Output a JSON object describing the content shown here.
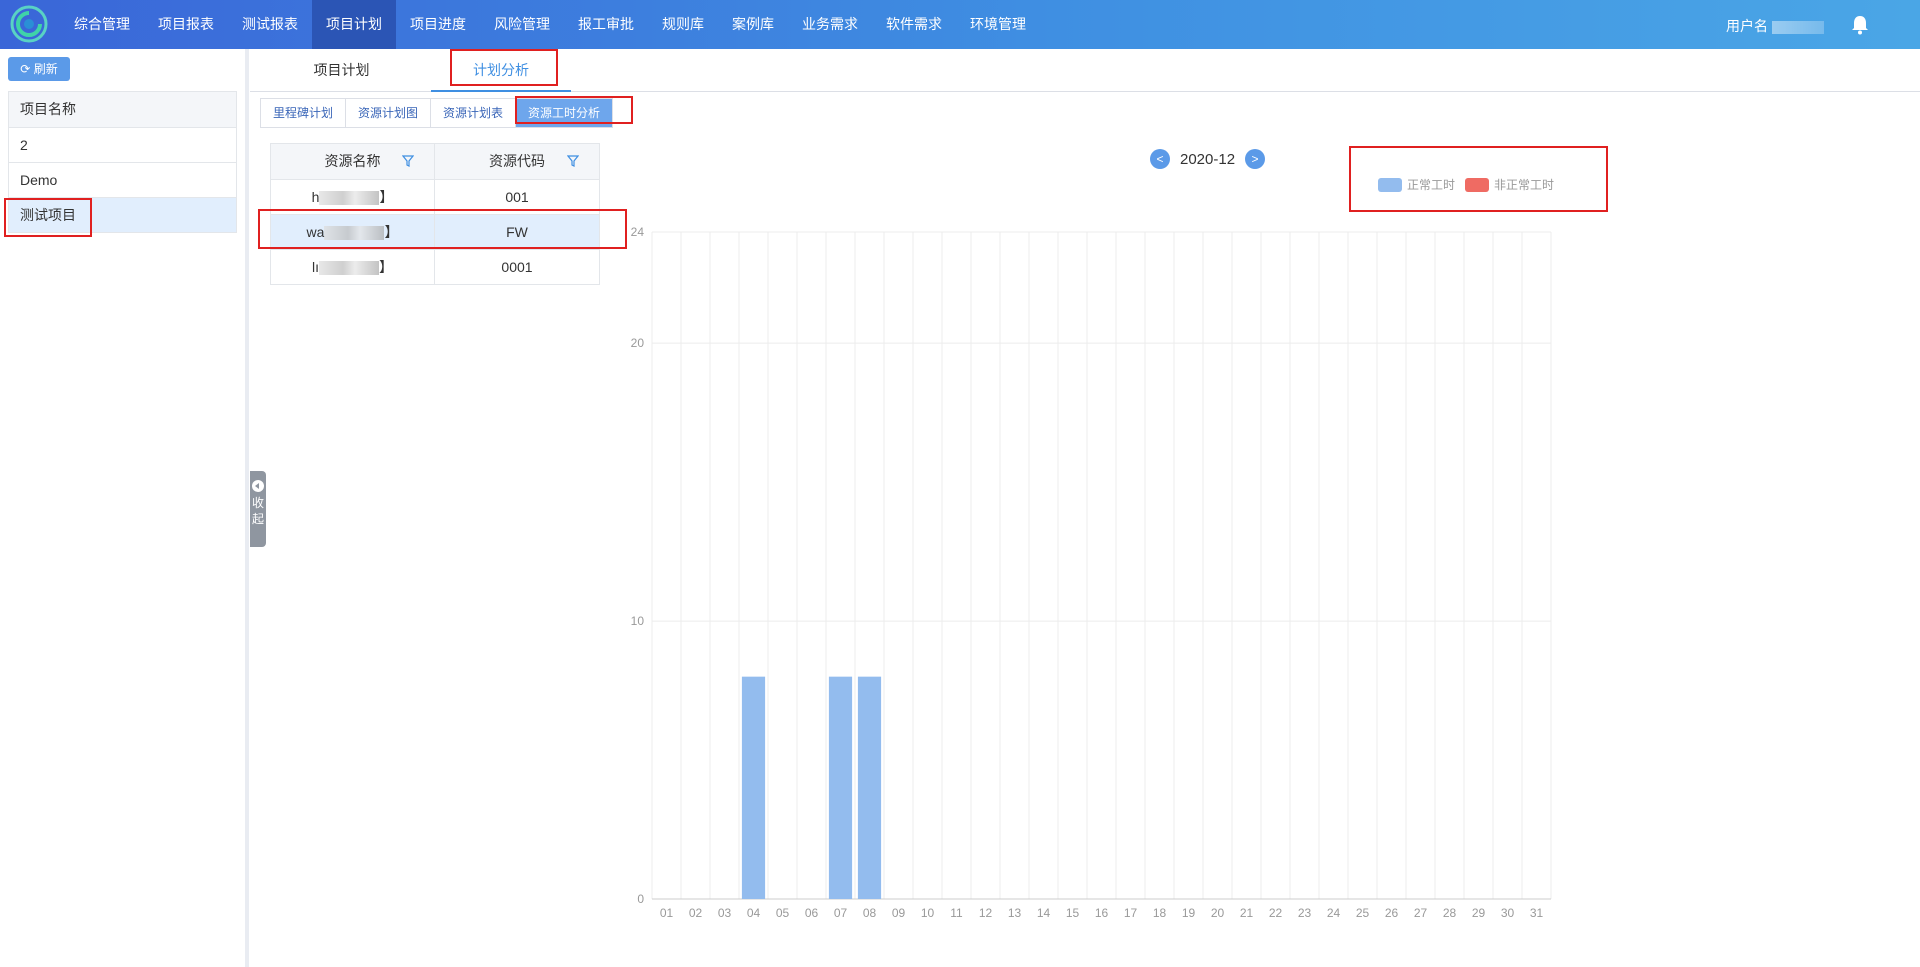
{
  "nav": {
    "items": [
      "综合管理",
      "项目报表",
      "测试报表",
      "项目计划",
      "项目进度",
      "风险管理",
      "报工审批",
      "规则库",
      "案例库",
      "业务需求",
      "软件需求",
      "环境管理"
    ],
    "active_index": 3,
    "user_label": "用户名"
  },
  "sidebar": {
    "refresh_label": "刷新",
    "header": "项目名称",
    "projects": [
      "2",
      "Demo",
      "测试项目"
    ],
    "selected_index": 2,
    "collapse_label": [
      "收",
      "起"
    ]
  },
  "tabs": {
    "main": [
      "项目计划",
      "计划分析"
    ],
    "active_main": 1,
    "sub": [
      "里程碑计划",
      "资源计划图",
      "资源计划表",
      "资源工时分析"
    ],
    "active_sub": 3
  },
  "resource_table": {
    "headers": [
      "资源名称",
      "资源代码"
    ],
    "rows": [
      {
        "name_prefix": "h",
        "name_suffix": "】",
        "code": "001"
      },
      {
        "name_prefix": "wa",
        "name_suffix": "】",
        "code": "FW"
      },
      {
        "name_prefix": "lı",
        "name_suffix": "】",
        "code": "0001"
      }
    ],
    "selected_index": 1
  },
  "month_nav": {
    "prev": "<",
    "next": ">",
    "label": "2020-12"
  },
  "colors": {
    "accent": "#3f8fe2",
    "normal": "#93bcee",
    "abnormal": "#ef6b63"
  },
  "chart_data": {
    "type": "bar",
    "categories": [
      "01",
      "02",
      "03",
      "04",
      "05",
      "06",
      "07",
      "08",
      "09",
      "10",
      "11",
      "12",
      "13",
      "14",
      "15",
      "16",
      "17",
      "18",
      "19",
      "20",
      "21",
      "22",
      "23",
      "24",
      "25",
      "26",
      "27",
      "28",
      "29",
      "30",
      "31"
    ],
    "series": [
      {
        "name": "正常工时",
        "values": [
          0,
          0,
          0,
          8,
          0,
          0,
          8,
          8,
          0,
          0,
          0,
          0,
          0,
          0,
          0,
          0,
          0,
          0,
          0,
          0,
          0,
          0,
          0,
          0,
          0,
          0,
          0,
          0,
          0,
          0,
          0
        ]
      },
      {
        "name": "非正常工时",
        "values": [
          0,
          0,
          0,
          0,
          0,
          0,
          0,
          0,
          0,
          0,
          0,
          0,
          0,
          0,
          0,
          0,
          0,
          0,
          0,
          0,
          0,
          0,
          0,
          0,
          0,
          0,
          0,
          0,
          0,
          0,
          0
        ]
      }
    ],
    "yticks": [
      0,
      10,
      20,
      24
    ],
    "ylim": [
      0,
      24
    ],
    "grid": true,
    "legend": "top-right"
  }
}
